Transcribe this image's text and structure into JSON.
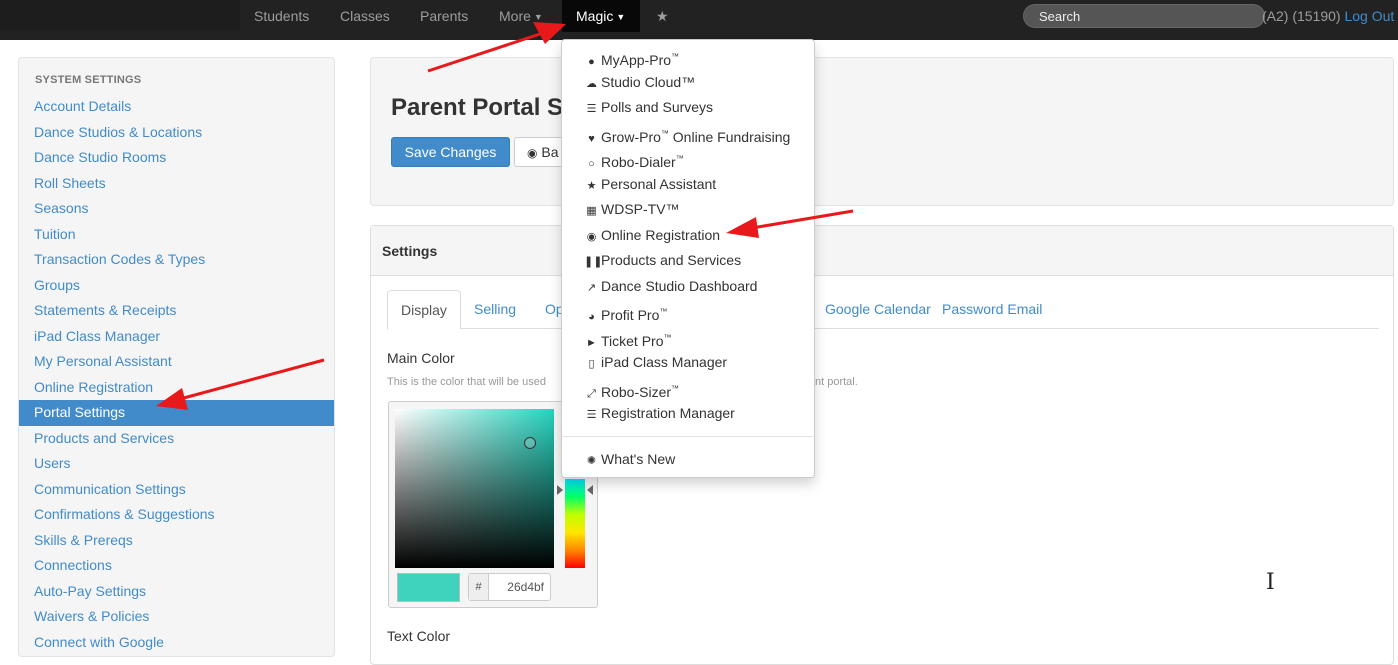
{
  "nav": {
    "items": [
      "Students",
      "Classes",
      "Parents",
      "More"
    ],
    "active": "Magic",
    "star": "★",
    "search_placeholder": "Search",
    "user_info": "(A2) (15190)",
    "logout": "Log Out"
  },
  "magic_menu": {
    "items": [
      {
        "label": "MyApp-Pro",
        "tm": "™",
        "icon": "apple-android-icon",
        "glyph": "&#63743;"
      },
      {
        "label": "Studio Cloud™",
        "tm": "",
        "icon": "cloud-icon"
      },
      {
        "label": "Polls and Surveys",
        "tm": "",
        "icon": "list-icon"
      },
      {
        "label": "Grow-Pro",
        "tm": "™",
        "label2": " Online Fundraising",
        "icon": "heart-icon"
      },
      {
        "label": "Robo-Dialer",
        "tm": "™",
        "icon": "comment-icon"
      },
      {
        "label": "Personal Assistant",
        "tm": "",
        "icon": "star-icon"
      },
      {
        "label": "WDSP-TV™",
        "tm": "",
        "icon": "film-icon"
      },
      {
        "label": "Online Registration",
        "tm": "",
        "icon": "globe-icon"
      },
      {
        "label": "Products and Services",
        "tm": "",
        "icon": "barcode-icon"
      },
      {
        "label": "Dance Studio Dashboard",
        "tm": "",
        "icon": "line-chart-icon"
      },
      {
        "label": "Profit Pro",
        "tm": "™",
        "icon": "pie-chart-icon"
      },
      {
        "label": "Ticket Pro",
        "tm": "™",
        "icon": "tags-icon"
      },
      {
        "label": "iPad Class Manager",
        "tm": "",
        "icon": "tablet-icon"
      },
      {
        "label": "Robo-Sizer",
        "tm": "™",
        "icon": "resize-icon"
      },
      {
        "label": "Registration Manager",
        "tm": "",
        "icon": "tasks-icon"
      }
    ],
    "whats_new": "What's New"
  },
  "sidebar": {
    "header": "SYSTEM SETTINGS",
    "items": [
      "Account Details",
      "Dance Studios & Locations",
      "Dance Studio Rooms",
      "Roll Sheets",
      "Seasons",
      "Tuition",
      "Transaction Codes & Types",
      "Groups",
      "Statements & Receipts",
      "iPad Class Manager",
      "My Personal Assistant",
      "Online Registration",
      "Portal Settings",
      "Products and Services",
      "Users",
      "Communication Settings",
      "Confirmations & Suggestions",
      "Skills & Prereqs",
      "Connections",
      "Auto-Pay Settings",
      "Waivers & Policies",
      "Connect with Google"
    ],
    "active_index": 12
  },
  "page": {
    "title": "Parent Portal S",
    "save_button": "Save Changes",
    "back_button": "Ba"
  },
  "settings": {
    "heading": "Settings",
    "tabs": [
      "Display",
      "Selling",
      "Op",
      "Google Calendar",
      "Password Email"
    ],
    "active_tab": "Display",
    "main_color_label": "Main Color",
    "main_color_help": "This is the color that will be used",
    "main_color_help_tail": "nt portal.",
    "hex_prefix": "#",
    "hex_value": "26d4bf",
    "text_color_label": "Text Color"
  },
  "colors": {
    "navbar": "#222222",
    "link": "#428bca",
    "selected_color": "#26d4bf",
    "annotation_arrow": "#e8191b"
  }
}
